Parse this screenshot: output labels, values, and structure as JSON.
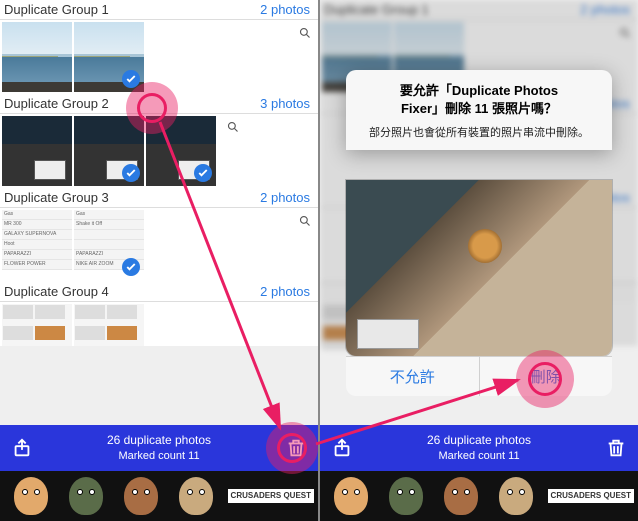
{
  "left": {
    "groups": [
      {
        "title": "Duplicate Group 1",
        "count": "2 photos"
      },
      {
        "title": "Duplicate Group 2",
        "count": "3 photos"
      },
      {
        "title": "Duplicate Group 3",
        "count": "2 photos"
      },
      {
        "title": "Duplicate Group 4",
        "count": "2 photos"
      }
    ],
    "toolbar": {
      "line1": "26 duplicate photos",
      "line2": "Marked count 11"
    }
  },
  "right": {
    "groups": [
      {
        "title": "Duplicate Group 1",
        "count": "2 photos"
      },
      {
        "title": "",
        "count": "photos"
      },
      {
        "title": "",
        "count": "photos"
      }
    ],
    "dialog": {
      "title_l1": "要允許「Duplicate Photos",
      "title_l2": "Fixer」刪除 11 張照片嗎？",
      "message": "部分照片也會從所有裝置的照片串流中刪除。",
      "deny": "不允許",
      "allow": "刪除"
    },
    "toolbar": {
      "line1": "26 duplicate photos",
      "line2": "Marked count 11"
    }
  },
  "ad": {
    "label": "CRUSADERS QUEST"
  },
  "colors": {
    "accent": "#2a7ae2",
    "highlight": "#e91e63"
  }
}
